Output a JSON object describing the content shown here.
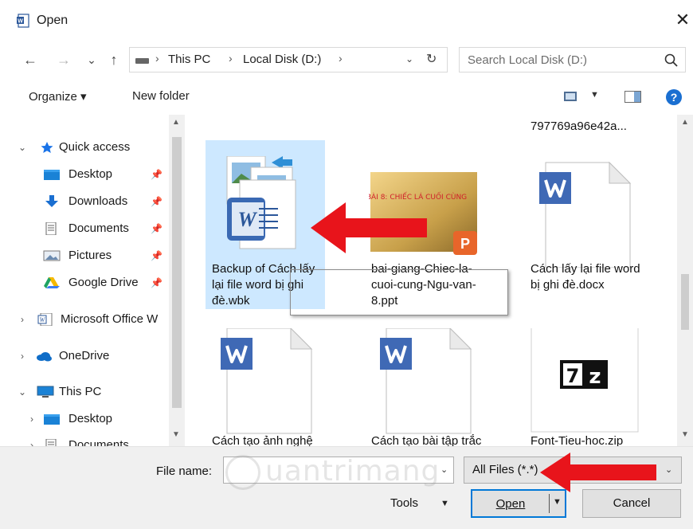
{
  "window": {
    "title": "Open",
    "close_glyph": "✕"
  },
  "navigation": {
    "back_glyph": "←",
    "forward_glyph": "→",
    "recent_glyph": "⌄",
    "up_glyph": "↑"
  },
  "address": {
    "crumbs": [
      "This PC",
      "Local Disk (D:)"
    ],
    "separator": "›",
    "dropdown_glyph": "⌄",
    "refresh_glyph": "↻"
  },
  "search": {
    "placeholder": "Search Local Disk (D:)"
  },
  "commandbar": {
    "organize_label": "Organize ▾",
    "new_folder_label": "New folder",
    "view_dropdown_glyph": "▼",
    "help_glyph": "?"
  },
  "nav_pane": {
    "items": [
      {
        "label": "Quick access",
        "icon": "star-icon",
        "expand": "⌄"
      },
      {
        "label": "Desktop",
        "icon": "desktop-folder-icon",
        "pin": "📌"
      },
      {
        "label": "Downloads",
        "icon": "download-arrow-icon",
        "pin": "📌"
      },
      {
        "label": "Documents",
        "icon": "documents-icon",
        "pin": "📌"
      },
      {
        "label": "Pictures",
        "icon": "pictures-icon",
        "pin": "📌"
      },
      {
        "label": "Google Drive",
        "icon": "google-drive-icon",
        "pin": "📌"
      },
      {
        "label": "Microsoft Office W",
        "icon": "office-word-icon",
        "expand": "›"
      },
      {
        "label": "OneDrive",
        "icon": "onedrive-cloud-icon",
        "expand": "›"
      },
      {
        "label": "This PC",
        "icon": "computer-icon",
        "expand": "⌄"
      },
      {
        "label": "Desktop",
        "icon": "desktop-folder-icon",
        "expand": "›"
      },
      {
        "label": "Documents",
        "icon": "documents-icon",
        "expand": "›"
      }
    ],
    "scroll_up_glyph": "▲",
    "scroll_down_glyph": "▼"
  },
  "files": {
    "top_truncated_label": "797769a96e42a...",
    "items": [
      {
        "name": "Backup of Cách lấy lại file word bị ghi đè.wbk",
        "icon": "word-backup-icon",
        "selected": true
      },
      {
        "name": "bai-giang-Chiec-la-cuoi-cung-Ngu-van-8.ppt",
        "icon": "powerpoint-thumbnail",
        "thumb_text": "BÀI 8: CHIẾC LÁ CUỐI CÙNG"
      },
      {
        "name": "Cách lấy lại file word bị ghi đè.docx",
        "icon": "word-document-icon"
      },
      {
        "name": "Cách tạo ảnh nghệ thuật",
        "icon": "word-document-icon"
      },
      {
        "name": "Cách tạo bài tập trắc nghiệm",
        "icon": "word-document-icon"
      },
      {
        "name": "Font-Tieu-hoc.zip",
        "icon": "7zip-archive-icon",
        "thumb_text": "7z"
      }
    ],
    "scroll_up_glyph": "▲",
    "scroll_down_glyph": "▼"
  },
  "bottom": {
    "file_name_label": "File name:",
    "file_name_value": "",
    "file_type_value": "All Files (*.*)",
    "tools_label": "Tools",
    "tools_dropdown_glyph": "▼",
    "open_label": "Open",
    "open_dropdown_glyph": "▼",
    "cancel_label": "Cancel",
    "dropdown_glyph": "⌄"
  },
  "watermark": {
    "text": "uantrimang"
  },
  "colors": {
    "selection": "#cde8ff",
    "accent": "#0078d7",
    "annotation_arrow": "#e8141b",
    "word_blue": "#2b579a",
    "ppt_orange": "#e8652a"
  }
}
